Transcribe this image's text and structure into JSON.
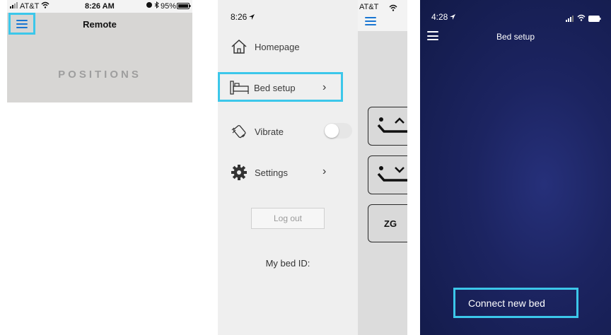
{
  "panel1": {
    "status": {
      "carrier": "AT&T",
      "time": "8:26 AM",
      "battery": "95%"
    },
    "header_title": "Remote",
    "section_label": "POSITIONS"
  },
  "panel2": {
    "status_time": "8:26",
    "status_carrier": "AT&T",
    "menu_items": [
      {
        "label": "Homepage"
      },
      {
        "label": "Bed setup"
      },
      {
        "label": "Vibrate"
      },
      {
        "label": "Settings"
      }
    ],
    "vibrate_toggle_on": false,
    "logout_label": "Log out",
    "bed_id_label": "My bed ID:",
    "remote_buttons": {
      "zg_label": "ZG"
    }
  },
  "panel3": {
    "status_time": "4:28",
    "title": "Bed setup",
    "connect_label": "Connect new bed"
  },
  "colors": {
    "highlight": "#3cc7ea",
    "menu_icon_blue": "#1976d2",
    "dark_bg": "#1c2461"
  }
}
